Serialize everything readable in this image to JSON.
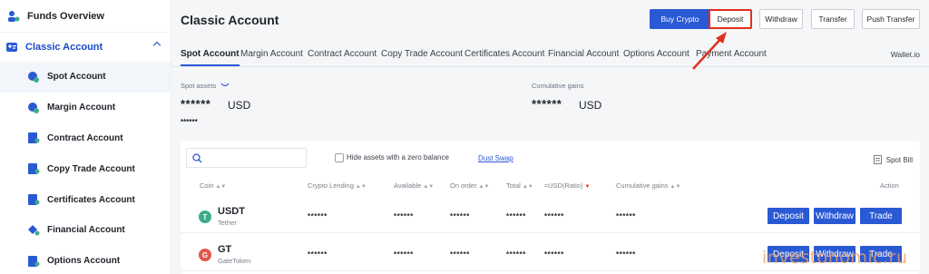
{
  "sidebar": {
    "top": "Funds Overview",
    "group": "Classic Account",
    "items": [
      {
        "label": "Spot Account",
        "icon": "spot-icon",
        "active": true
      },
      {
        "label": "Margin Account",
        "icon": "margin-icon"
      },
      {
        "label": "Contract Account",
        "icon": "contract-icon"
      },
      {
        "label": "Copy Trade Account",
        "icon": "copy-trade-icon"
      },
      {
        "label": "Certificates Account",
        "icon": "certificate-icon"
      },
      {
        "label": "Financial Account",
        "icon": "financial-icon"
      },
      {
        "label": "Options Account",
        "icon": "options-icon"
      }
    ]
  },
  "header": {
    "title": "Classic Account",
    "buttons": {
      "buy_crypto": "Buy Crypto",
      "deposit": "Deposit",
      "withdraw": "Withdraw",
      "transfer": "Transfer",
      "push_transfer": "Push Transfer"
    }
  },
  "tabs": [
    "Spot Account",
    "Margin Account",
    "Contract Account",
    "Copy Trade Account",
    "Certificates Account",
    "Financial Account",
    "Options Account",
    "Payment Account"
  ],
  "wallet_link": "Wallet.io",
  "stats": {
    "spot_label": "Spot assets",
    "spot_value": "******",
    "spot_unit": "USD",
    "spot_sub": "******",
    "gains_label": "Cumulative gains",
    "gains_value": "******",
    "gains_unit": "USD"
  },
  "filters": {
    "search_placeholder": "",
    "hide_zero": "Hide assets with a zero balance",
    "dust_swap": "Dust Swap",
    "spot_bill": "Spot Bill"
  },
  "table": {
    "columns": [
      "Coin",
      "Crypto Lending",
      "Available",
      "On order",
      "Total",
      "≈USD(Ratio)",
      "Cumulative gains",
      "Action"
    ],
    "rows": [
      {
        "symbol": "USDT",
        "name": "Tether",
        "icon_letter": "T",
        "icon_color": "#3eab8c",
        "lending": "******",
        "available": "******",
        "on_order": "******",
        "total": "******",
        "usd": "******",
        "gains": "******",
        "actions": [
          "Deposit",
          "Withdraw",
          "Trade"
        ]
      },
      {
        "symbol": "GT",
        "name": "GateToken",
        "icon_letter": "G",
        "icon_color": "#e2574c",
        "lending": "******",
        "available": "******",
        "on_order": "******",
        "total": "******",
        "usd": "******",
        "gains": "******",
        "actions": [
          "Deposit",
          "Withdraw",
          "Trade"
        ]
      }
    ]
  },
  "watermark": "investonomic.ru",
  "colors": {
    "accent": "#2a59d4",
    "highlight": "#e0301e"
  }
}
